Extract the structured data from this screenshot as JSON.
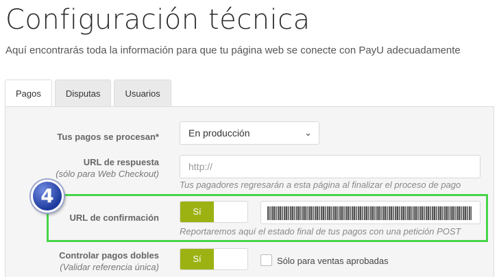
{
  "page": {
    "title": "Configuración técnica",
    "subtitle": "Aquí encontrarás toda la información para que tu página web se conecte con PayU adecuadamente"
  },
  "tabs": [
    {
      "label": "Pagos",
      "active": true
    },
    {
      "label": "Disputas",
      "active": false
    },
    {
      "label": "Usuarios",
      "active": false
    }
  ],
  "form": {
    "process": {
      "label": "Tus pagos se procesan*",
      "value": "En producción"
    },
    "response_url": {
      "label": "URL de respuesta",
      "sublabel": "(sólo para Web Checkout)",
      "placeholder": "http://",
      "help": "Tus pagadores regresarán a esta página al finalizar el proceso de pago"
    },
    "confirmation_url": {
      "label": "URL de confirmación",
      "toggle": "Sí",
      "help": "Reportaremos aquí el estado final de tus pagos con una petición POST"
    },
    "double_payments": {
      "label": "Controlar pagos dobles",
      "sublabel": "(Validar referencia única)",
      "toggle": "Sí",
      "checkbox_label": "Sólo para ventas aprobadas"
    }
  },
  "annotation": {
    "step": "4",
    "highlight_color": "#47d44a",
    "badge_color": "#1e3a9e"
  },
  "colors": {
    "toggle_on": "#9cb212",
    "panel_bg": "#f5f5f5"
  },
  "icons": {
    "select": "chevron-down-icon"
  }
}
